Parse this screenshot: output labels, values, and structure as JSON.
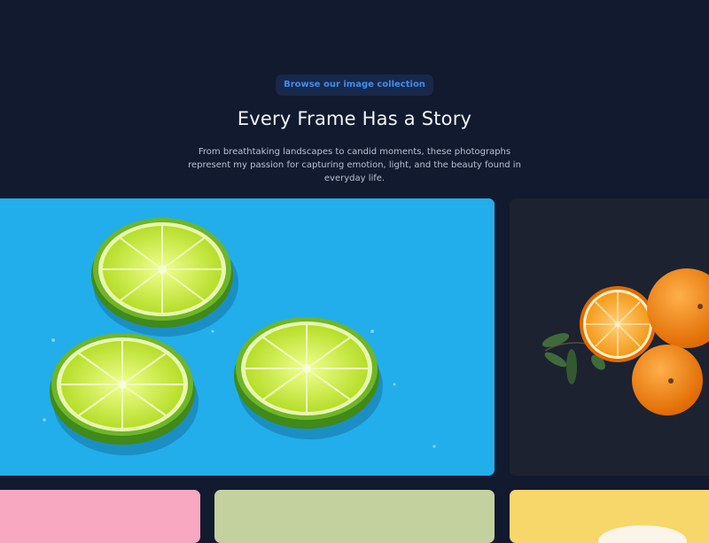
{
  "hero": {
    "badge": "Browse our image collection",
    "title": "Every Frame Has a Story",
    "description": "From breathtaking landscapes to candid moments, these photographs represent my passion for capturing emotion, light, and the beauty found in everyday life."
  },
  "gallery": {
    "items": [
      {
        "subject": "lime halves on blue background",
        "color": "#22aeea"
      },
      {
        "subject": "mandarin oranges with leaves on dark background",
        "color": "#1c2230"
      },
      {
        "subject": "pink photo (partially visible)",
        "color": "#f9a8c2"
      },
      {
        "subject": "sage green photo (partially visible)",
        "color": "#c3d19f"
      },
      {
        "subject": "yellow photo (partially visible)",
        "color": "#f7d76a"
      }
    ]
  },
  "colors": {
    "background": "#111a2e",
    "accent": "#3d8ef0"
  }
}
